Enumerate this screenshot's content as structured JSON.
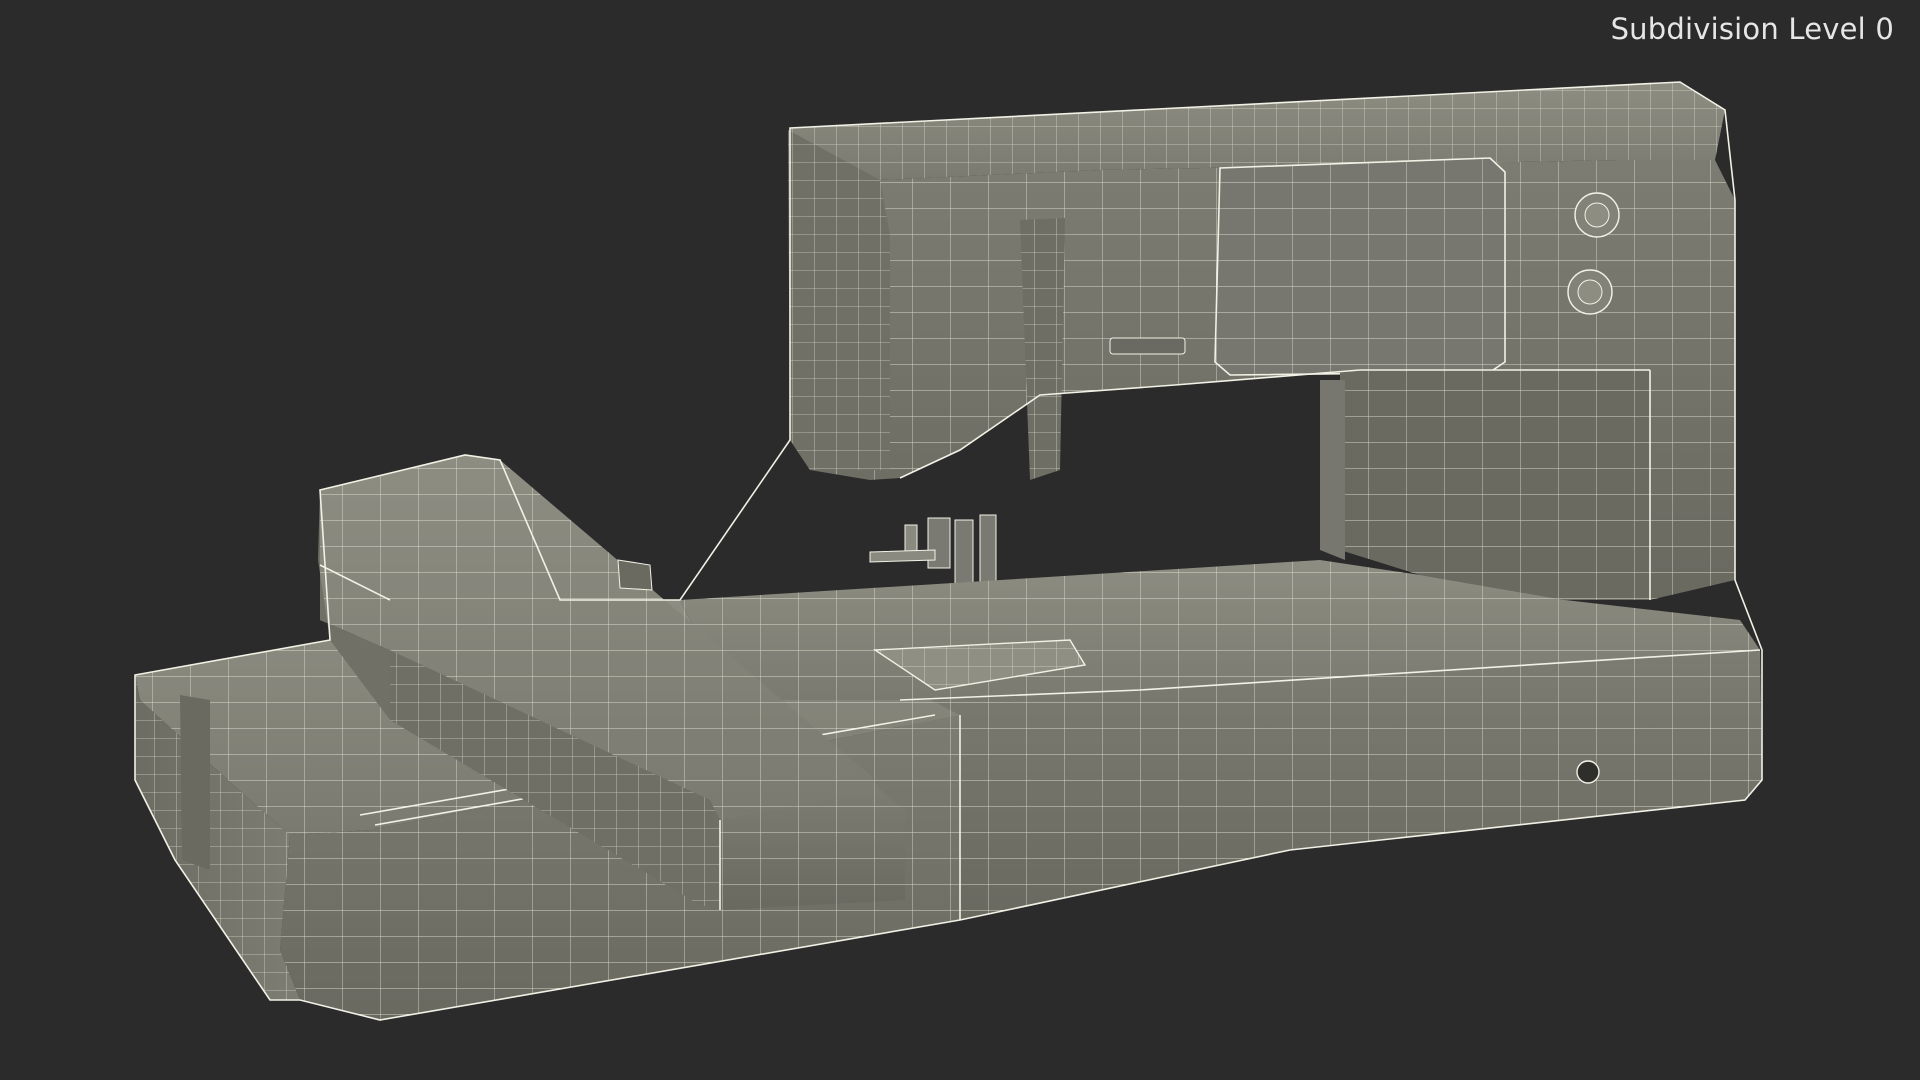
{
  "viewport": {
    "overlay_label": "Subdivision Level 0"
  },
  "colors": {
    "background": "#2b2b2b",
    "surface": "#7b7b70",
    "surface_light": "#8c8c80",
    "surface_dark": "#5f5f56",
    "wire": "#e9e9dc",
    "label": "#e6e6e6"
  },
  "model": {
    "subject": "sewing-machine-wireframe"
  }
}
